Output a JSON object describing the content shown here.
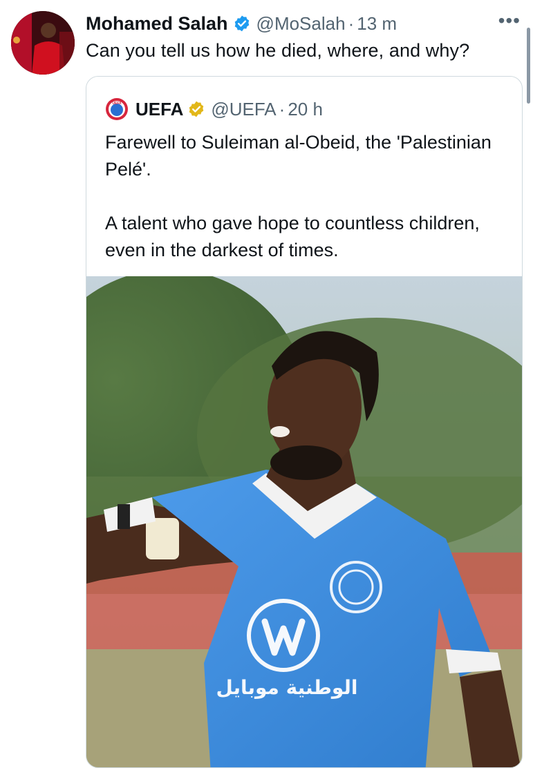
{
  "tweet": {
    "author_name": "Mohamed Salah",
    "handle": "@MoSalah",
    "separator": "·",
    "time": "13 m",
    "more_label": "•••",
    "text": "Can you tell us how he died, where, and why?"
  },
  "quoted_tweet": {
    "author_name": "UEFA",
    "handle": "@UEFA",
    "separator": "·",
    "time": "20 h",
    "paragraphs": [
      "Farewell to Suleiman al-Obeid, the 'Palestinian Pelé'.",
      "A talent who gave hope to countless children, even in the darkest of times."
    ],
    "logo_text": "UEFA",
    "media": {
      "sponsor_text": "الوطنية موبايل"
    }
  },
  "colors": {
    "verified_blue": "#1d9bf0",
    "verified_gold": "#e2b719",
    "secondary_text": "#536471",
    "jersey_blue": "#3d8fe0",
    "uefa_red": "#d7263d"
  },
  "icons": {
    "verified": "verified-badge-icon",
    "more": "more-options-icon",
    "logo": "uefa-logo-icon"
  }
}
